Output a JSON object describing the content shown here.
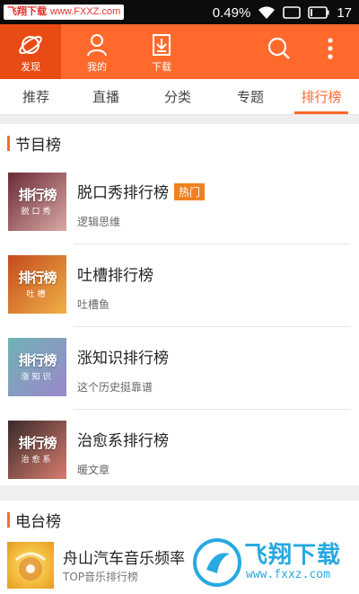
{
  "statusbar": {
    "watermark_site": "飞翔下载",
    "watermark_url": "www.FXXZ.com",
    "battery_percent": "0.49%",
    "time": "17"
  },
  "appbar": {
    "nav": [
      {
        "label": "发现",
        "icon": "planet-icon",
        "active": true
      },
      {
        "label": "我的",
        "icon": "person-icon",
        "active": false
      },
      {
        "label": "下载",
        "icon": "download-icon",
        "active": false
      }
    ],
    "actions": [
      "search-icon",
      "more-vertical-icon"
    ]
  },
  "tabs": [
    {
      "label": "推荐",
      "active": false
    },
    {
      "label": "直播",
      "active": false
    },
    {
      "label": "分类",
      "active": false
    },
    {
      "label": "专题",
      "active": false
    },
    {
      "label": "排行榜",
      "active": true
    }
  ],
  "program_section": {
    "title": "节目榜",
    "items": [
      {
        "title": "脱口秀排行榜",
        "badge": "热门",
        "subtitle": "逻辑思维",
        "thumb_big": "排行榜",
        "thumb_small": "脱口秀",
        "thumb_colors": [
          "#6b2a36",
          "#d9a9a4"
        ]
      },
      {
        "title": "吐槽排行榜",
        "badge": "",
        "subtitle": "吐槽鱼",
        "thumb_big": "排行榜",
        "thumb_small": "吐槽",
        "thumb_colors": [
          "#c44a1f",
          "#f0b145"
        ]
      },
      {
        "title": "涨知识排行榜",
        "badge": "",
        "subtitle": "这个历史挺靠谱",
        "thumb_big": "排行榜",
        "thumb_small": "涨知识",
        "thumb_colors": [
          "#6fb3b5",
          "#9b87c9"
        ]
      },
      {
        "title": "治愈系排行榜",
        "badge": "",
        "subtitle": "暖文章",
        "thumb_big": "排行榜",
        "thumb_small": "治愈系",
        "thumb_colors": [
          "#3a2a2a",
          "#d87c6e"
        ]
      }
    ]
  },
  "radio_section": {
    "title": "电台榜",
    "items": [
      {
        "title": "舟山汽车音乐频率",
        "subtitle": "TOP音乐排行榜"
      }
    ]
  },
  "watermark": {
    "brand": "飞翔下载",
    "url": "www.fxxz.com"
  },
  "colors": {
    "accent": "#ff6a2c",
    "accent_dark": "#e94b14",
    "badge": "#f1811f",
    "watermark": "#27a9e1"
  }
}
